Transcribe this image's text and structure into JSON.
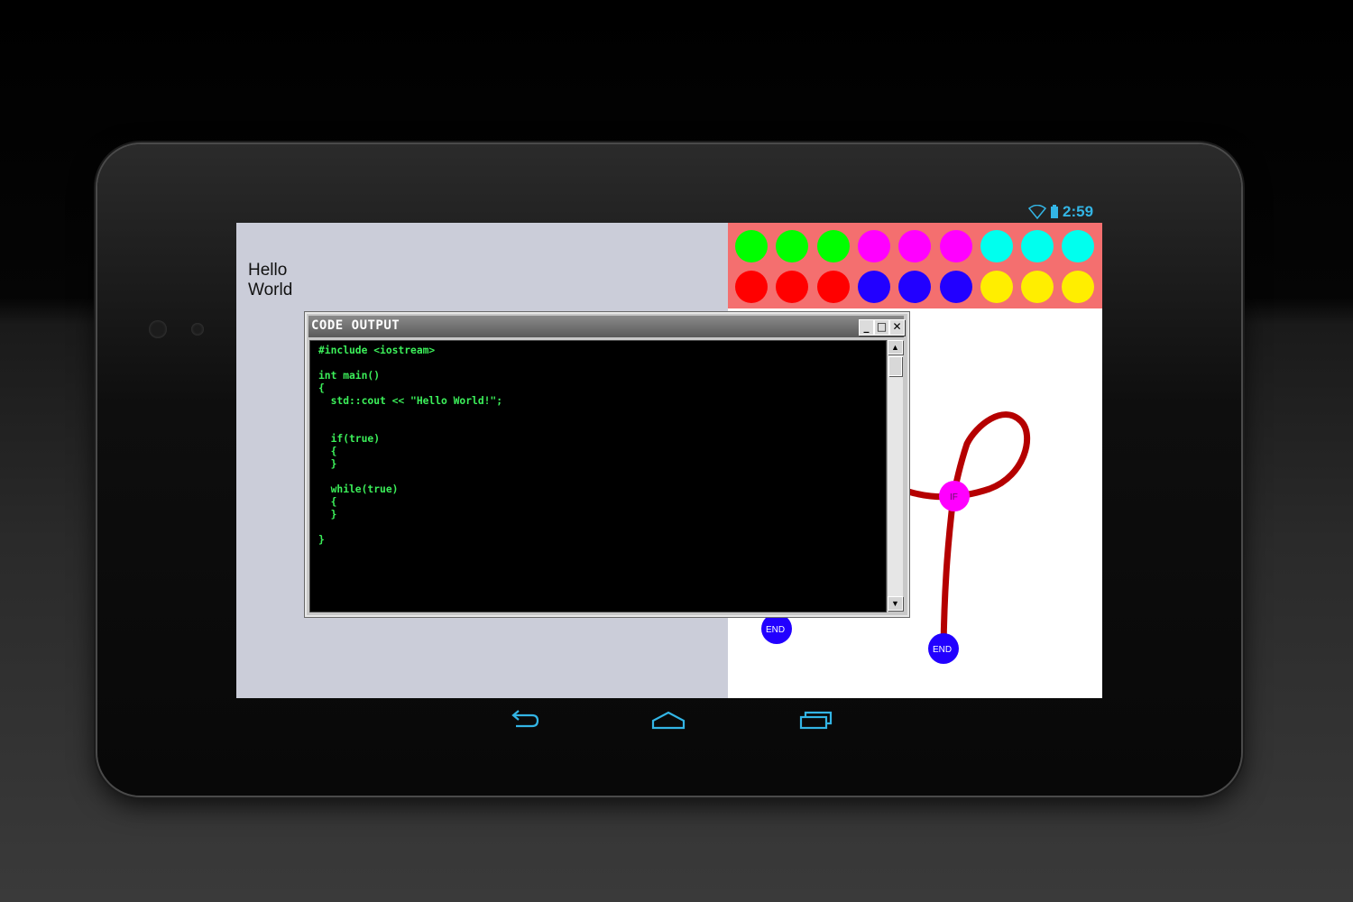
{
  "status_bar": {
    "time": "2:59",
    "wifi_icon": "wifi-icon",
    "battery_icon": "battery-icon",
    "color": "#33b5e5"
  },
  "left_pane": {
    "text": "Hello World",
    "background": "#cbcdd9"
  },
  "palette": {
    "background": "#f46f6f",
    "rows": [
      [
        "#00ff00",
        "#00ff00",
        "#00ff00",
        "#ff00ff",
        "#ff00ff",
        "#ff00ff",
        "#00ffee",
        "#00ffee",
        "#00ffee"
      ],
      [
        "#ff0000",
        "#ff0000",
        "#ff0000",
        "#2200ff",
        "#2200ff",
        "#2200ff",
        "#ffee00",
        "#ffee00",
        "#ffee00"
      ]
    ]
  },
  "flow": {
    "if_label": "IF",
    "end_label_1": "END",
    "end_label_2": "END",
    "path_color": "#b50000",
    "if_color": "#ff00ff",
    "end_color": "#2200ff"
  },
  "code_window": {
    "title": "CODE OUTPUT",
    "minimize_label": "_",
    "maximize_label": "□",
    "close_label": "✕",
    "code": "#include <iostream>\n\nint main()\n{\n  std::cout << \"Hello World!\";\n\n\n  if(true)\n  {\n  }\n\n  while(true)\n  {\n  }\n\n}",
    "code_color": "#3cf05a"
  },
  "navbar": {
    "back_icon": "back-icon",
    "home_icon": "home-icon",
    "recents_icon": "recent-apps-icon"
  }
}
